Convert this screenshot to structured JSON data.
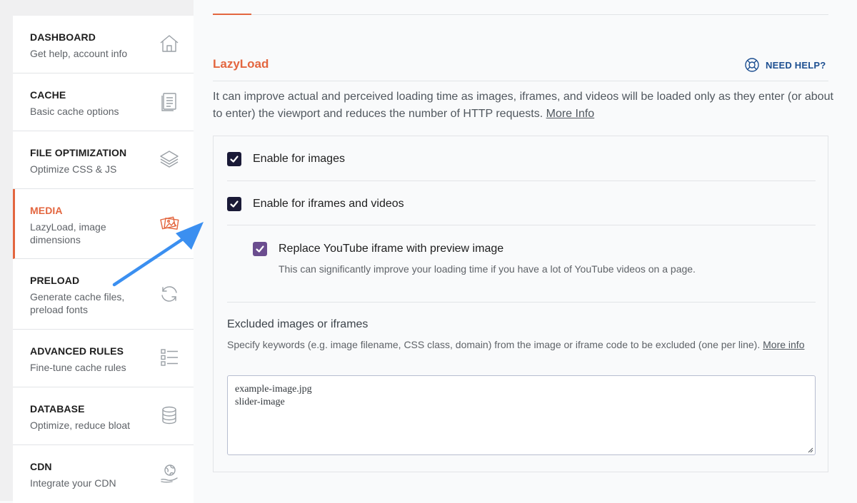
{
  "sidebar": {
    "items": [
      {
        "title": "DASHBOARD",
        "subtitle": "Get help, account info",
        "icon": "home-icon"
      },
      {
        "title": "CACHE",
        "subtitle": "Basic cache options",
        "icon": "document-icon"
      },
      {
        "title": "FILE OPTIMIZATION",
        "subtitle": "Optimize CSS & JS",
        "icon": "layers-icon"
      },
      {
        "title": "MEDIA",
        "subtitle_lines": [
          "LazyLoad, image",
          "dimensions"
        ],
        "icon": "photos-icon",
        "active": true
      },
      {
        "title": "PRELOAD",
        "subtitle_lines": [
          "Generate cache files,",
          "preload fonts"
        ],
        "icon": "refresh-icon"
      },
      {
        "title": "ADVANCED RULES",
        "subtitle": "Fine-tune cache rules",
        "icon": "checklist-icon"
      },
      {
        "title": "DATABASE",
        "subtitle": "Optimize, reduce bloat",
        "icon": "database-icon"
      },
      {
        "title": "CDN",
        "subtitle": "Integrate your CDN",
        "icon": "globe-hand-icon"
      }
    ]
  },
  "main": {
    "section_title": "LazyLoad",
    "help_label": "NEED HELP?",
    "intro_text": "It can improve actual and perceived loading time as images, iframes, and videos will be loaded only as they enter (or about to enter) the viewport and reduces the number of HTTP requests. ",
    "intro_link": "More Info",
    "options": {
      "images": {
        "label": "Enable for images",
        "checked": true
      },
      "iframes": {
        "label": "Enable for iframes and videos",
        "checked": true
      },
      "youtube": {
        "label": "Replace YouTube iframe with preview image",
        "note": "This can significantly improve your loading time if you have a lot of YouTube videos on a page.",
        "checked": true
      }
    },
    "excluded": {
      "title": "Excluded images or iframes",
      "description": "Specify keywords (e.g. image filename, CSS class, domain) from the image or iframe code to be excluded (one per line). ",
      "link": "More info",
      "lines": [
        "example-image.jpg",
        "slider-image"
      ]
    }
  },
  "colors": {
    "accent": "#e3663f",
    "checkbox": "#1a1a37",
    "checkbox_sub": "#6b4d8f",
    "help": "#1d4f91",
    "annotation_arrow": "#3b8ff0"
  }
}
